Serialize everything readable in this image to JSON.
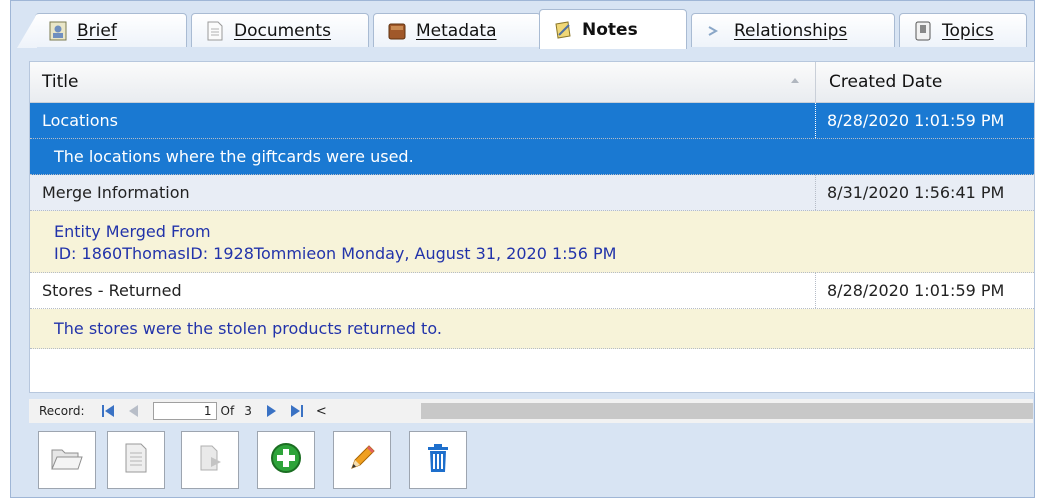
{
  "tabs": [
    {
      "label": "Brief",
      "icon": "brief-icon",
      "active": false
    },
    {
      "label": "Documents",
      "icon": "documents-icon",
      "active": false
    },
    {
      "label": "Metadata",
      "icon": "metadata-icon",
      "active": false
    },
    {
      "label": "Notes",
      "icon": "notes-icon",
      "active": true
    },
    {
      "label": "Relationships",
      "icon": "relationships-icon",
      "active": false
    },
    {
      "label": "Topics",
      "icon": "topics-icon",
      "active": false
    }
  ],
  "grid": {
    "columns": {
      "title": "Title",
      "created": "Created Date"
    },
    "rows": [
      {
        "title": "Locations",
        "created": "8/28/2020 1:01:59 PM",
        "note": [
          "The locations where the giftcards were used."
        ],
        "selected": true
      },
      {
        "title": "Merge Information",
        "created": "8/31/2020 1:56:41 PM",
        "note": [
          "Entity Merged From",
          "ID: 1860ThomasID: 1928Tommieon Monday, August 31, 2020 1:56 PM"
        ],
        "selected": false
      },
      {
        "title": "Stores - Returned",
        "created": "8/28/2020 1:01:59 PM",
        "note": [
          "The stores were the stolen products returned to."
        ],
        "selected": false
      }
    ]
  },
  "navigator": {
    "label": "Record:",
    "current": "1",
    "of_label": "Of",
    "total": "3",
    "scroll_left": "<"
  },
  "toolbar": [
    {
      "name": "open-folder-icon",
      "enabled": false
    },
    {
      "name": "document-icon",
      "enabled": false
    },
    {
      "name": "export-icon",
      "enabled": false
    },
    {
      "name": "add-icon",
      "enabled": true
    },
    {
      "name": "edit-pencil-icon",
      "enabled": true
    },
    {
      "name": "delete-trash-icon",
      "enabled": true
    }
  ],
  "colors": {
    "selection": "#1a79d2",
    "note_text": "#2233aa",
    "note_bg": "#f7f3d9",
    "frame_bg": "#d8e4f3"
  }
}
